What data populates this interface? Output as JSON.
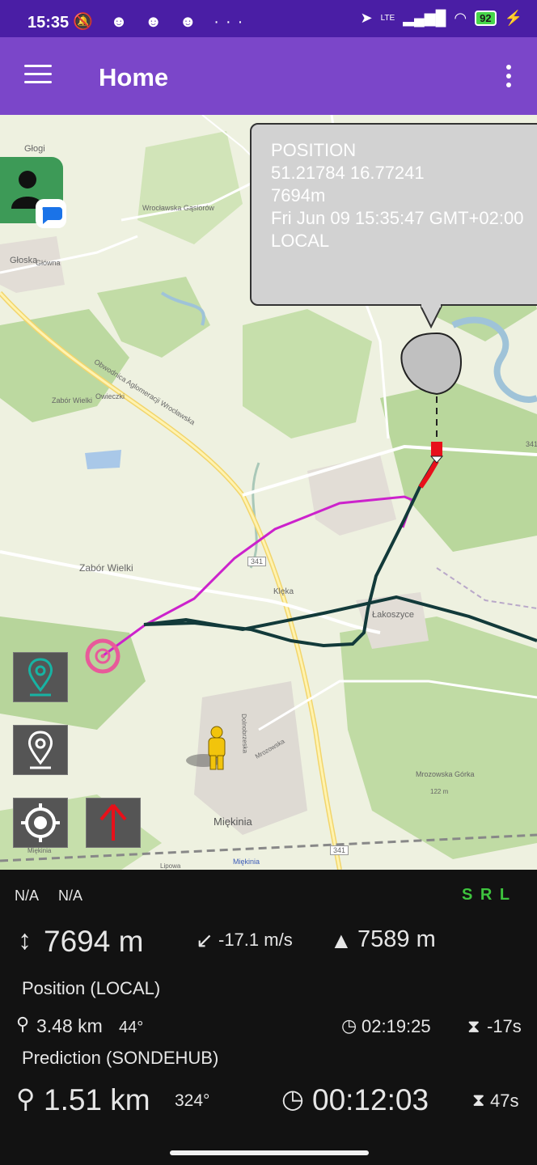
{
  "status_bar": {
    "time": "15:35",
    "network": "LTE",
    "battery": "92",
    "icons": [
      "muted-bell-icon",
      "discord-icon",
      "discord-icon",
      "discord-icon",
      "more-dots-icon",
      "location-arrow-icon",
      "signal-icon",
      "wifi-icon",
      "battery-icon",
      "charging-icon"
    ]
  },
  "app_bar": {
    "title": "Home",
    "menu_icon": "hamburger-icon",
    "overflow_icon": "more-vert-icon"
  },
  "map": {
    "place_labels": {
      "glogi": "Głogi",
      "gloska": "Głoska",
      "gasiorow": "Wrocławska Gąsiorów",
      "glowna": "Główna",
      "obwodnica": "Obwodnica Aglomeracji Wrocławska",
      "zabor_wielki_small": "Zabór Wielki",
      "owieczki": "Owieczki",
      "zabor_wielki": "Zabór Wielki",
      "route_341a": "341",
      "route_341b": "341",
      "route_341c": "341",
      "klecka": "Klęka",
      "lakoszyce": "Łakoszyce",
      "miekinia": "Miękinia",
      "miekinia_small": "Miękinia",
      "miekinia_station": "Miękinia",
      "dolnobrzeska": "Dolnobrzeska",
      "mrozowska": "Mrozowska",
      "mrozowska_gorka": "Mrozowska Górka",
      "height_122": "122 m",
      "lipowa": "Lipowa"
    },
    "callout": {
      "title": "POSITION",
      "coords": "51.21784 16.77241",
      "altitude": "7694m",
      "timestamp": "Fri Jun 09 15:35:47 GMT+02:00",
      "source": "LOCAL"
    },
    "buttons": {
      "marker_teal_icon": "map-marker-teal-icon",
      "marker_white_icon": "map-marker-white-icon",
      "locate_icon": "gps-target-icon",
      "arrow_icon": "red-up-arrow-icon"
    },
    "colors": {
      "prediction_track": "#cc22cc",
      "flight_track": "#123a3a",
      "landing_target": "#e85a9a",
      "balloon": "#c0c0c0",
      "payload": "#e8101a"
    }
  },
  "panel": {
    "left_na1": "N/A",
    "left_na2": "N/A",
    "srl": "S R L",
    "altitude": "7694 m",
    "vspeed": "-17.1 m/s",
    "max_alt": "7589 m",
    "position_label": "Position (LOCAL)",
    "pos_distance": "3.48 km",
    "pos_bearing": "44°",
    "pos_time": "02:19:25",
    "pos_age": "-17s",
    "prediction_label": "Prediction (SONDEHUB)",
    "pred_distance": "1.51 km",
    "pred_bearing": "324°",
    "pred_time": "00:12:03",
    "pred_age": "47s",
    "srl_color": "#3ec43e"
  }
}
